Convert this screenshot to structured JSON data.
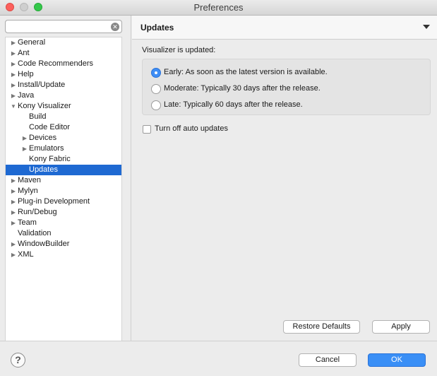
{
  "window": {
    "title": "Preferences"
  },
  "filter": {
    "value": "",
    "placeholder": ""
  },
  "tree": {
    "items": [
      {
        "label": "General",
        "expandable": true,
        "expanded": false,
        "level": 0
      },
      {
        "label": "Ant",
        "expandable": true,
        "expanded": false,
        "level": 0
      },
      {
        "label": "Code Recommenders",
        "expandable": true,
        "expanded": false,
        "level": 0
      },
      {
        "label": "Help",
        "expandable": true,
        "expanded": false,
        "level": 0
      },
      {
        "label": "Install/Update",
        "expandable": true,
        "expanded": false,
        "level": 0
      },
      {
        "label": "Java",
        "expandable": true,
        "expanded": false,
        "level": 0
      },
      {
        "label": "Kony Visualizer",
        "expandable": true,
        "expanded": true,
        "level": 0
      },
      {
        "label": "Build",
        "expandable": false,
        "level": 1
      },
      {
        "label": "Code Editor",
        "expandable": false,
        "level": 1
      },
      {
        "label": "Devices",
        "expandable": true,
        "expanded": false,
        "level": 1
      },
      {
        "label": "Emulators",
        "expandable": true,
        "expanded": false,
        "level": 1
      },
      {
        "label": "Kony Fabric",
        "expandable": false,
        "level": 1
      },
      {
        "label": "Updates",
        "expandable": false,
        "level": 1,
        "selected": true
      },
      {
        "label": "Maven",
        "expandable": true,
        "expanded": false,
        "level": 0
      },
      {
        "label": "Mylyn",
        "expandable": true,
        "expanded": false,
        "level": 0
      },
      {
        "label": "Plug-in Development",
        "expandable": true,
        "expanded": false,
        "level": 0
      },
      {
        "label": "Run/Debug",
        "expandable": true,
        "expanded": false,
        "level": 0
      },
      {
        "label": "Team",
        "expandable": true,
        "expanded": false,
        "level": 0
      },
      {
        "label": "Validation",
        "expandable": false,
        "level": 0
      },
      {
        "label": "WindowBuilder",
        "expandable": true,
        "expanded": false,
        "level": 0
      },
      {
        "label": "XML",
        "expandable": true,
        "expanded": false,
        "level": 0
      }
    ]
  },
  "page": {
    "title": "Updates",
    "section_label": "Visualizer is updated:",
    "options": [
      {
        "label": "Early: As soon as the latest version is available.",
        "checked": true
      },
      {
        "label": "Moderate: Typically 30 days after the release.",
        "checked": false
      },
      {
        "label": "Late: Typically 60 days after the release.",
        "checked": false
      }
    ],
    "auto_updates": {
      "label": "Turn off auto updates",
      "checked": false
    },
    "restore_label": "Restore Defaults",
    "apply_label": "Apply"
  },
  "footer": {
    "help_symbol": "?",
    "cancel_label": "Cancel",
    "ok_label": "OK"
  },
  "colors": {
    "selection": "#1e69d2",
    "ok_button": "#3a8ff6",
    "radio_checked": "#3f8ef5"
  }
}
